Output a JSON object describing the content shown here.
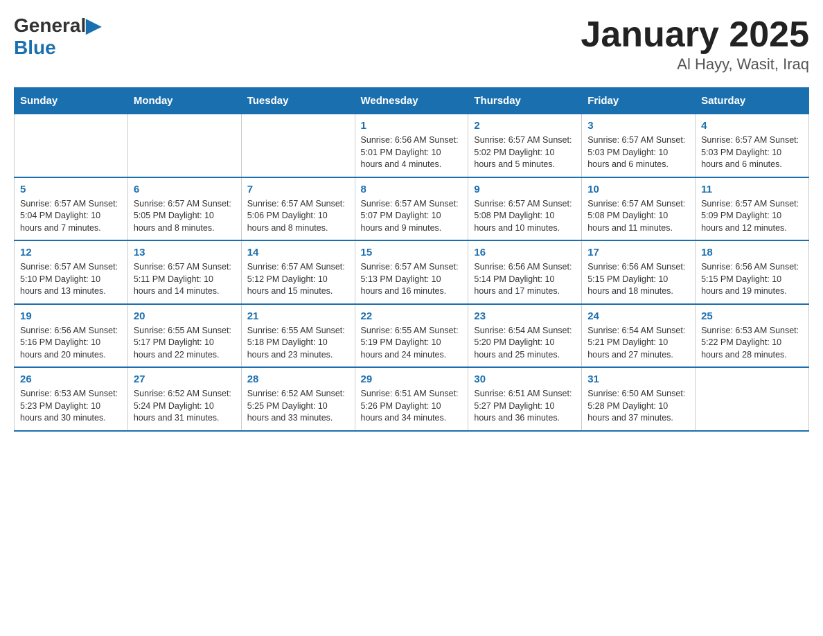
{
  "logo": {
    "general": "General",
    "blue": "Blue"
  },
  "title": "January 2025",
  "subtitle": "Al Hayy, Wasit, Iraq",
  "days_of_week": [
    "Sunday",
    "Monday",
    "Tuesday",
    "Wednesday",
    "Thursday",
    "Friday",
    "Saturday"
  ],
  "weeks": [
    [
      {
        "day": "",
        "info": ""
      },
      {
        "day": "",
        "info": ""
      },
      {
        "day": "",
        "info": ""
      },
      {
        "day": "1",
        "info": "Sunrise: 6:56 AM\nSunset: 5:01 PM\nDaylight: 10 hours and 4 minutes."
      },
      {
        "day": "2",
        "info": "Sunrise: 6:57 AM\nSunset: 5:02 PM\nDaylight: 10 hours and 5 minutes."
      },
      {
        "day": "3",
        "info": "Sunrise: 6:57 AM\nSunset: 5:03 PM\nDaylight: 10 hours and 6 minutes."
      },
      {
        "day": "4",
        "info": "Sunrise: 6:57 AM\nSunset: 5:03 PM\nDaylight: 10 hours and 6 minutes."
      }
    ],
    [
      {
        "day": "5",
        "info": "Sunrise: 6:57 AM\nSunset: 5:04 PM\nDaylight: 10 hours and 7 minutes."
      },
      {
        "day": "6",
        "info": "Sunrise: 6:57 AM\nSunset: 5:05 PM\nDaylight: 10 hours and 8 minutes."
      },
      {
        "day": "7",
        "info": "Sunrise: 6:57 AM\nSunset: 5:06 PM\nDaylight: 10 hours and 8 minutes."
      },
      {
        "day": "8",
        "info": "Sunrise: 6:57 AM\nSunset: 5:07 PM\nDaylight: 10 hours and 9 minutes."
      },
      {
        "day": "9",
        "info": "Sunrise: 6:57 AM\nSunset: 5:08 PM\nDaylight: 10 hours and 10 minutes."
      },
      {
        "day": "10",
        "info": "Sunrise: 6:57 AM\nSunset: 5:08 PM\nDaylight: 10 hours and 11 minutes."
      },
      {
        "day": "11",
        "info": "Sunrise: 6:57 AM\nSunset: 5:09 PM\nDaylight: 10 hours and 12 minutes."
      }
    ],
    [
      {
        "day": "12",
        "info": "Sunrise: 6:57 AM\nSunset: 5:10 PM\nDaylight: 10 hours and 13 minutes."
      },
      {
        "day": "13",
        "info": "Sunrise: 6:57 AM\nSunset: 5:11 PM\nDaylight: 10 hours and 14 minutes."
      },
      {
        "day": "14",
        "info": "Sunrise: 6:57 AM\nSunset: 5:12 PM\nDaylight: 10 hours and 15 minutes."
      },
      {
        "day": "15",
        "info": "Sunrise: 6:57 AM\nSunset: 5:13 PM\nDaylight: 10 hours and 16 minutes."
      },
      {
        "day": "16",
        "info": "Sunrise: 6:56 AM\nSunset: 5:14 PM\nDaylight: 10 hours and 17 minutes."
      },
      {
        "day": "17",
        "info": "Sunrise: 6:56 AM\nSunset: 5:15 PM\nDaylight: 10 hours and 18 minutes."
      },
      {
        "day": "18",
        "info": "Sunrise: 6:56 AM\nSunset: 5:15 PM\nDaylight: 10 hours and 19 minutes."
      }
    ],
    [
      {
        "day": "19",
        "info": "Sunrise: 6:56 AM\nSunset: 5:16 PM\nDaylight: 10 hours and 20 minutes."
      },
      {
        "day": "20",
        "info": "Sunrise: 6:55 AM\nSunset: 5:17 PM\nDaylight: 10 hours and 22 minutes."
      },
      {
        "day": "21",
        "info": "Sunrise: 6:55 AM\nSunset: 5:18 PM\nDaylight: 10 hours and 23 minutes."
      },
      {
        "day": "22",
        "info": "Sunrise: 6:55 AM\nSunset: 5:19 PM\nDaylight: 10 hours and 24 minutes."
      },
      {
        "day": "23",
        "info": "Sunrise: 6:54 AM\nSunset: 5:20 PM\nDaylight: 10 hours and 25 minutes."
      },
      {
        "day": "24",
        "info": "Sunrise: 6:54 AM\nSunset: 5:21 PM\nDaylight: 10 hours and 27 minutes."
      },
      {
        "day": "25",
        "info": "Sunrise: 6:53 AM\nSunset: 5:22 PM\nDaylight: 10 hours and 28 minutes."
      }
    ],
    [
      {
        "day": "26",
        "info": "Sunrise: 6:53 AM\nSunset: 5:23 PM\nDaylight: 10 hours and 30 minutes."
      },
      {
        "day": "27",
        "info": "Sunrise: 6:52 AM\nSunset: 5:24 PM\nDaylight: 10 hours and 31 minutes."
      },
      {
        "day": "28",
        "info": "Sunrise: 6:52 AM\nSunset: 5:25 PM\nDaylight: 10 hours and 33 minutes."
      },
      {
        "day": "29",
        "info": "Sunrise: 6:51 AM\nSunset: 5:26 PM\nDaylight: 10 hours and 34 minutes."
      },
      {
        "day": "30",
        "info": "Sunrise: 6:51 AM\nSunset: 5:27 PM\nDaylight: 10 hours and 36 minutes."
      },
      {
        "day": "31",
        "info": "Sunrise: 6:50 AM\nSunset: 5:28 PM\nDaylight: 10 hours and 37 minutes."
      },
      {
        "day": "",
        "info": ""
      }
    ]
  ]
}
